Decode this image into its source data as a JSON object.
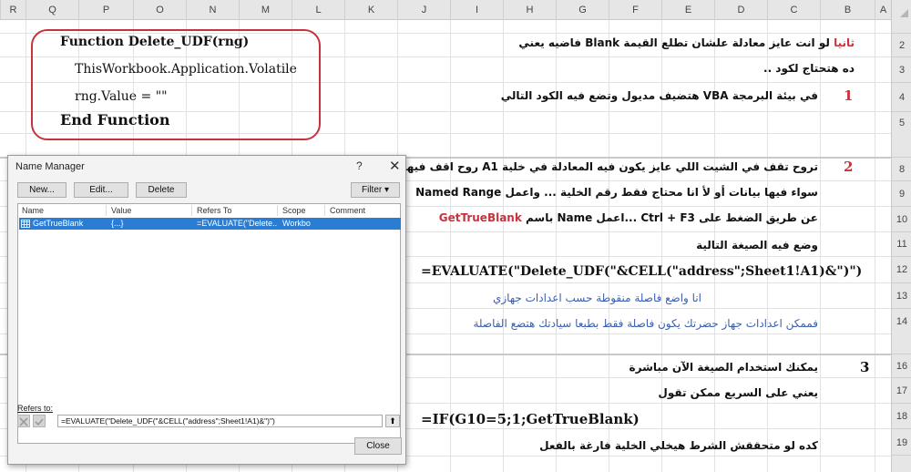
{
  "columns": [
    "R",
    "Q",
    "P",
    "O",
    "N",
    "M",
    "L",
    "K",
    "J",
    "I",
    "H",
    "G",
    "F",
    "E",
    "D",
    "C",
    "B",
    "A"
  ],
  "rows": [
    "2",
    "3",
    "4",
    "5",
    "8",
    "9",
    "10",
    "11",
    "12",
    "13",
    "14",
    "16",
    "17",
    "18",
    "19"
  ],
  "code": {
    "line1": "Function Delete_UDF(rng)",
    "line2": "ThisWorkbook.Application.Volatile",
    "line3": "rng.Value = \"\"",
    "line4": "End Function"
  },
  "sheet": {
    "r2_red": "ثانيا",
    "r2_a": "لو انت عايز معادلة علشان تطلع القيمة",
    "r2_b": "Blank",
    "r2_c": "فاضيه يعني",
    "r3": "ده هتحتاج لكود ..",
    "n1": "1",
    "r4_a": "في بيئة البرمجة",
    "r4_b": "VBA",
    "r4_c": "هتضيف مديول وتضع فيه الكود التالي",
    "n2": "2",
    "r8_a": "تروح تقف في الشيت اللي عايز يكون فيه المعادلة في خلية",
    "r8_b": "A1",
    "r8_c": "روح اقف فيها",
    "r9_a": "سواء فيها بيانات أو لأ انا محتاج فقط رقم الخلية ... واعمل",
    "r9_b": "Named Range",
    "r10_a": "عن طريق الضغط على",
    "r10_b": "Ctrl + F3",
    "r10_c": "...اعمل",
    "r10_d": "Name",
    "r10_e": "باسم",
    "r10_f": "GetTrueBlank",
    "r11": "وضع فيه الصيغة التالية",
    "r12": "=EVALUATE(\"Delete_UDF(\"&CELL(\"address\";Sheet1!A1)&\")\")",
    "r13": "انا واضع فاصلة منقوطة حسب اعدادات جهازي",
    "r14": "فممكن اعدادات جهاز حضرتك يكون فاصلة فقط بطبعا سيادتك هتضع الفاصلة",
    "n3": "3",
    "r16": "يمكنك استخدام الصيغة الآن مباشرة",
    "r17": "يعني على السريع ممكن تقول",
    "r18": "=IF(G10=5;1;GetTrueBlank)",
    "r19": "كده لو متحققش الشرط هيخلي الخلية فارغة بالفعل"
  },
  "dialog": {
    "title": "Name Manager",
    "help": "?",
    "close_x": "✕",
    "btn_new": "New...",
    "btn_edit": "Edit...",
    "btn_delete": "Delete",
    "btn_filter": "Filter ▾",
    "headers": {
      "name": "Name",
      "value": "Value",
      "refers": "Refers To",
      "scope": "Scope",
      "comment": "Comment"
    },
    "row": {
      "name": "GetTrueBlank",
      "value": "{...}",
      "refers": "=EVALUATE(\"Delete...",
      "scope": "Workbo",
      "comment": ""
    },
    "refers_label": "Refers to:",
    "refers_value": "=EVALUATE(\"Delete_UDF(\"&CELL(\"address\";Sheet1!A1)&\")\")",
    "collapse": "⬆",
    "close_btn": "Close"
  },
  "colors": {
    "accent_red": "#c8323c",
    "selection_blue": "#2b7cd3",
    "text_blue": "#3b5fae"
  }
}
